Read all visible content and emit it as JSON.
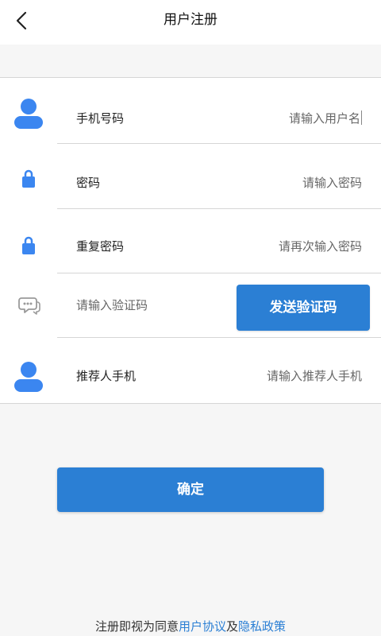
{
  "header": {
    "title": "用户注册"
  },
  "form": {
    "phone": {
      "label": "手机号码",
      "placeholder": "请输入用户名"
    },
    "password": {
      "label": "密码",
      "placeholder": "请输入密码"
    },
    "repeat_password": {
      "label": "重复密码",
      "placeholder": "请再次输入密码"
    },
    "verify_code": {
      "placeholder": "请输入验证码",
      "send_button": "发送验证码"
    },
    "referrer": {
      "label": "推荐人手机",
      "placeholder": "请输入推荐人手机"
    }
  },
  "confirm_button": "确定",
  "agreement": {
    "prefix": "注册即视为同意",
    "user_agreement": "用户协议",
    "and": "及",
    "privacy_policy": "隐私政策"
  },
  "colors": {
    "accent": "#2b7fd4",
    "icon": "#3b86f0",
    "background": "#f6f6f6"
  },
  "icons": {
    "back": "chevron-left-icon",
    "phone": "user-icon",
    "password": "lock-icon",
    "repeat_password": "lock-icon",
    "verify_code": "chat-bubble-icon",
    "referrer": "user-icon"
  }
}
